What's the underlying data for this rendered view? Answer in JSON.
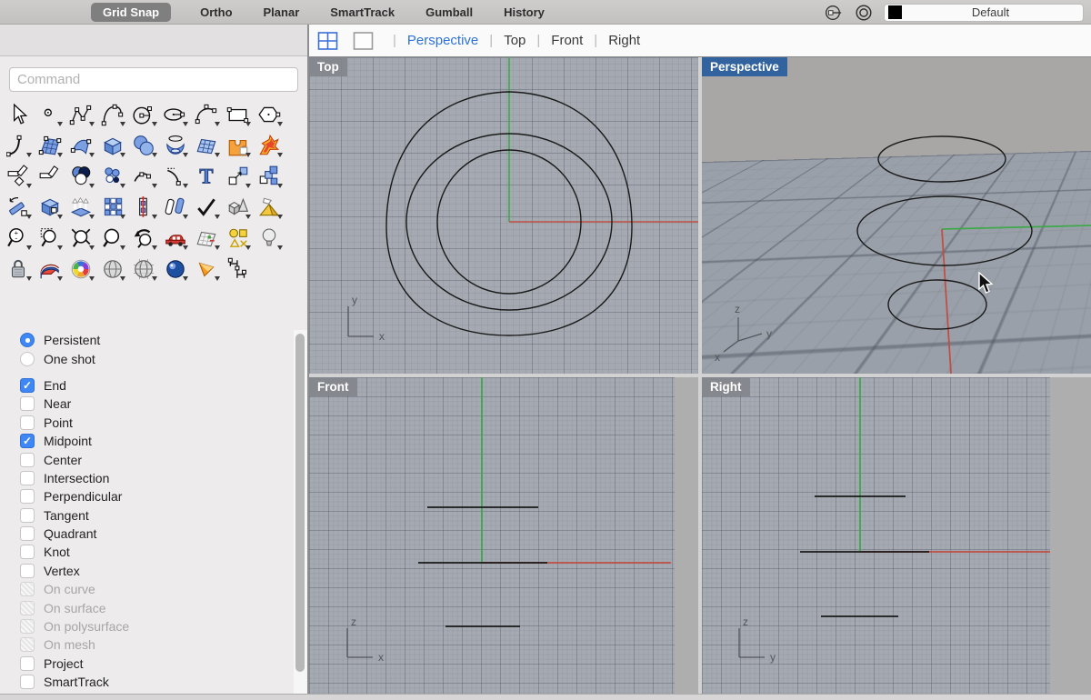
{
  "menubar": {
    "buttons": [
      {
        "label": "Grid Snap",
        "active": true
      },
      {
        "label": "Ortho",
        "active": false
      },
      {
        "label": "Planar",
        "active": false
      },
      {
        "label": "SmartTrack",
        "active": false
      },
      {
        "label": "Gumball",
        "active": false
      },
      {
        "label": "History",
        "active": false
      }
    ],
    "right_buttons": [
      {
        "name": "record-history"
      },
      {
        "name": "gumball"
      }
    ],
    "layer_selector": {
      "label": "Default",
      "swatch_color": "#000000"
    }
  },
  "tabstrip": {
    "pane_buttons": [
      {
        "name": "four-pane"
      },
      {
        "name": "single-pane"
      }
    ],
    "separator": "|",
    "tabs": [
      {
        "label": "Perspective",
        "active": true
      },
      {
        "label": "Top",
        "active": false
      },
      {
        "label": "Front",
        "active": false
      },
      {
        "label": "Right",
        "active": false
      }
    ]
  },
  "sidebar": {
    "command": {
      "placeholder": "Command"
    },
    "toolbar_rows": [
      [
        "select",
        "single-point",
        "control-point-curve",
        "curve-freeform",
        "circle",
        "ellipse",
        "arc",
        "rectangle",
        "polygon"
      ],
      [
        "blend-curve",
        "surface-from-points",
        "sweep-surface",
        "box",
        "sphere",
        "revolve",
        "patch",
        "boolean-union",
        "explode"
      ],
      [
        "fillet",
        "chamfer",
        "curve-boolean",
        "point-cloud",
        "adjust-curve",
        "extend-curve",
        "text",
        "move",
        "copy"
      ],
      [
        "rotate",
        "shell-solid",
        "extrude-surface",
        "rectangular-array",
        "split",
        "offset-curve",
        "points-on",
        "group",
        "unroll-surface"
      ],
      [
        "zoom-dynamic",
        "zoom-window",
        "zoom-extents",
        "zoom-selected",
        "undo-view",
        "named-views",
        "layout",
        "layer-objects",
        "lights"
      ],
      [
        "lock",
        "shell",
        "color-wheel",
        "shaded-viewport",
        "wireframe-viewport",
        "rendered-viewport",
        "spotlight",
        "dimension"
      ]
    ],
    "osnap": {
      "radio_group": [
        {
          "label": "Persistent",
          "selected": true
        },
        {
          "label": "One shot",
          "selected": false
        }
      ],
      "options": [
        {
          "label": "End",
          "checked": true,
          "disabled": false
        },
        {
          "label": "Near",
          "checked": false,
          "disabled": false
        },
        {
          "label": "Point",
          "checked": false,
          "disabled": false
        },
        {
          "label": "Midpoint",
          "checked": true,
          "disabled": false
        },
        {
          "label": "Center",
          "checked": false,
          "disabled": false
        },
        {
          "label": "Intersection",
          "checked": false,
          "disabled": false
        },
        {
          "label": "Perpendicular",
          "checked": false,
          "disabled": false
        },
        {
          "label": "Tangent",
          "checked": false,
          "disabled": false
        },
        {
          "label": "Quadrant",
          "checked": false,
          "disabled": false
        },
        {
          "label": "Knot",
          "checked": false,
          "disabled": false
        },
        {
          "label": "Vertex",
          "checked": false,
          "disabled": false
        },
        {
          "label": "On curve",
          "checked": false,
          "disabled": true
        },
        {
          "label": "On surface",
          "checked": false,
          "disabled": true
        },
        {
          "label": "On polysurface",
          "checked": false,
          "disabled": true
        },
        {
          "label": "On mesh",
          "checked": false,
          "disabled": true
        },
        {
          "label": "Project",
          "checked": false,
          "disabled": false
        },
        {
          "label": "SmartTrack",
          "checked": false,
          "disabled": false
        }
      ]
    }
  },
  "viewports": {
    "top": {
      "label": "Top",
      "axes": {
        "h": "x",
        "v": "y"
      }
    },
    "perspective": {
      "label": "Perspective",
      "axes": {
        "up": "z",
        "right": "y",
        "left": "x"
      }
    },
    "front": {
      "label": "Front",
      "axes": {
        "h": "x",
        "v": "z"
      }
    },
    "right": {
      "label": "Right",
      "axes": {
        "h": "y",
        "v": "z"
      }
    }
  },
  "colors": {
    "active_tab": "#2e72d9",
    "axis_green": "#3da94b",
    "axis_red": "#bf4f44",
    "active_badge": "#33639e",
    "selection_blue": "#3e87f5"
  }
}
